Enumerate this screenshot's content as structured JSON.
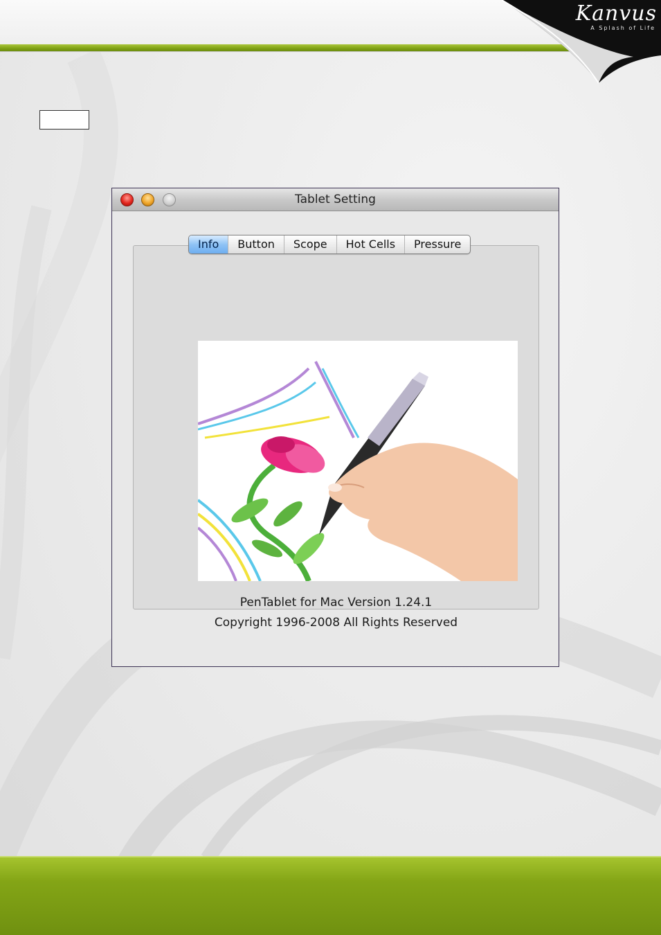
{
  "brand": {
    "logo_text": "Kanvus",
    "tagline": "A Splash of Life"
  },
  "page": {
    "number_box": ""
  },
  "window": {
    "title": "Tablet Setting",
    "tabs": [
      {
        "label": "Info",
        "active": true
      },
      {
        "label": "Button",
        "active": false
      },
      {
        "label": "Scope",
        "active": false
      },
      {
        "label": "Hot Cells",
        "active": false
      },
      {
        "label": "Pressure",
        "active": false
      }
    ],
    "version_text": "PenTablet for Mac Version 1.24.1",
    "copyright_text": "Copyright 1996-2008 All Rights Reserved"
  },
  "colors": {
    "accent_green": "#7fa115",
    "active_tab_blue": "#6eaef0",
    "close_red": "#e3251d",
    "minimize_orange": "#f0a62a"
  },
  "icons": [
    "close-icon",
    "minimize-icon",
    "zoom-icon",
    "pen-illustration-icon"
  ]
}
